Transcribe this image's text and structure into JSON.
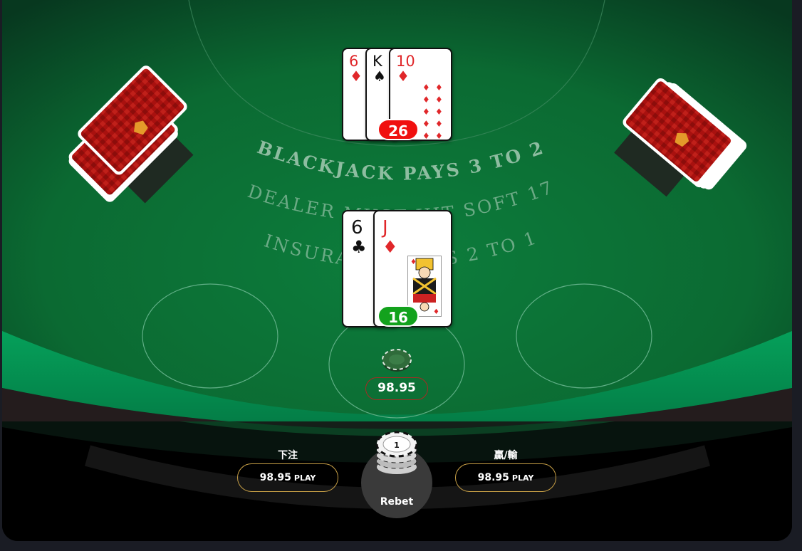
{
  "table": {
    "arc_line_1": "BLACKJACK PAYS 3 TO 2",
    "arc_line_2": "DEALER MUST HIT SOFT 17",
    "arc_line_3": "INSURANCE PAYS 2 TO 1",
    "felt_color": "#0b6a34",
    "rim_color": "#04864a"
  },
  "dealer": {
    "cards": [
      {
        "rank": "6",
        "suit": "♦",
        "color": "red"
      },
      {
        "rank": "K",
        "suit": "♠",
        "color": "black"
      },
      {
        "rank": "10",
        "suit": "♦",
        "color": "red"
      }
    ],
    "score": "26"
  },
  "player": {
    "cards": [
      {
        "rank": "6",
        "suit": "♣",
        "color": "black"
      },
      {
        "rank": "J",
        "suit": "♦",
        "color": "red"
      }
    ],
    "score": "16"
  },
  "bet": {
    "amount": "98.95"
  },
  "controls": {
    "stake_label": "下注",
    "stake_value": "98.95",
    "stake_unit": "PLAY",
    "win_label": "贏/輸",
    "win_value": "98.95",
    "win_unit": "PLAY",
    "rebet_label": "Rebet",
    "chip_value": "1"
  }
}
